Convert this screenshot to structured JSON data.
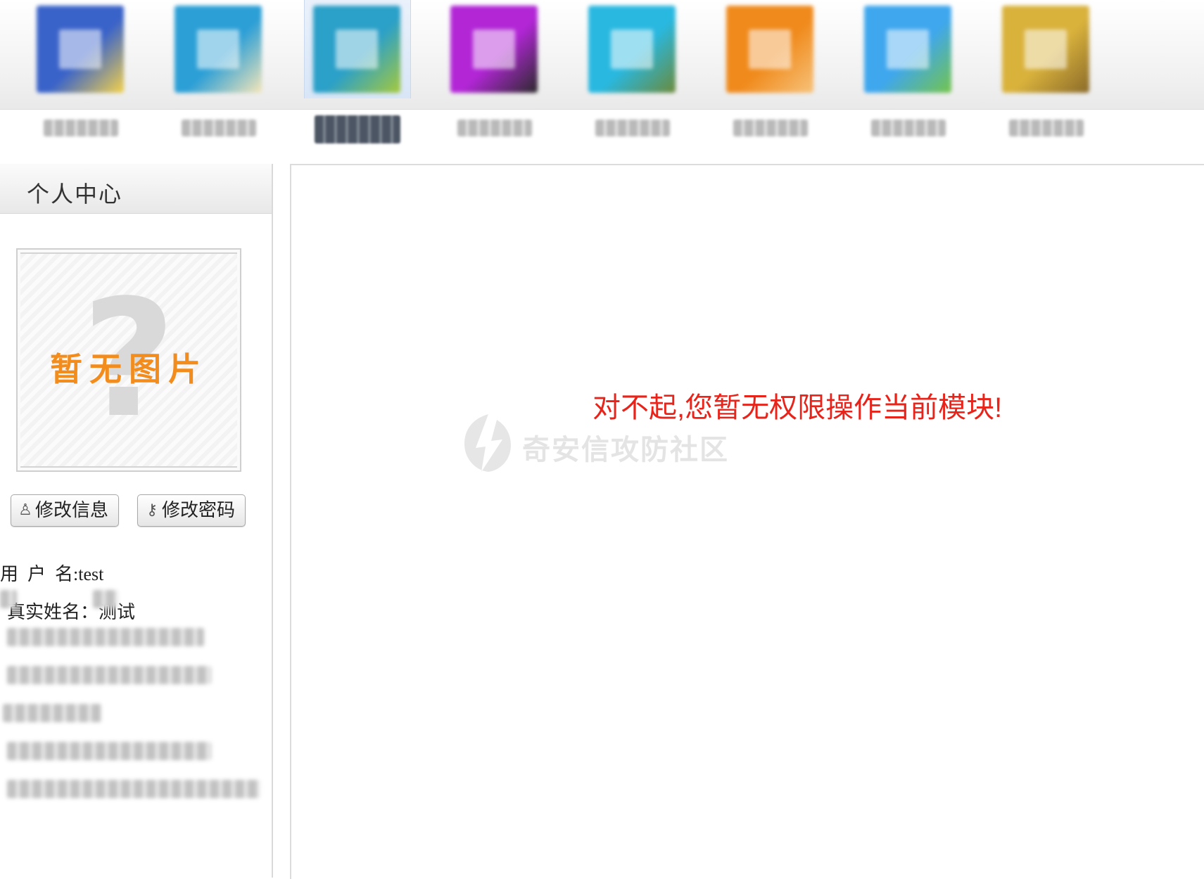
{
  "toolbar": {
    "modules": [
      {
        "colors": [
          "#3a63c9",
          "#f4d24a"
        ],
        "active": false
      },
      {
        "colors": [
          "#2c9fd6",
          "#f5e6b8"
        ],
        "active": false
      },
      {
        "colors": [
          "#2ba0c8",
          "#a6c93a"
        ],
        "active": true
      },
      {
        "colors": [
          "#b226d6",
          "#2a2a2a"
        ],
        "active": false
      },
      {
        "colors": [
          "#29b8e0",
          "#6b8a3a"
        ],
        "active": false
      },
      {
        "colors": [
          "#f08a1c",
          "#f7c27a"
        ],
        "active": false
      },
      {
        "colors": [
          "#3fa7ee",
          "#74c44a"
        ],
        "active": false
      },
      {
        "colors": [
          "#d9b23c",
          "#8a6a2a"
        ],
        "active": false
      }
    ]
  },
  "left_panel": {
    "title": "个人中心",
    "avatar_placeholder": "暂无图片",
    "avatar_icon": "question-mark-icon",
    "buttons": {
      "edit_info": "修改信息",
      "edit_password": "修改密码"
    },
    "info": {
      "username_label": "用  户  名:",
      "username_value": "test",
      "realname_label": "真实姓名：",
      "realname_value": "测试"
    }
  },
  "main": {
    "error_message": "对不起,您暂无权限操作当前模块!",
    "watermark": "奇安信攻防社区"
  },
  "colors": {
    "error_red": "#e8231a",
    "placeholder_orange": "#f28c1d",
    "active_tab_bg": "#d8e6f7"
  }
}
